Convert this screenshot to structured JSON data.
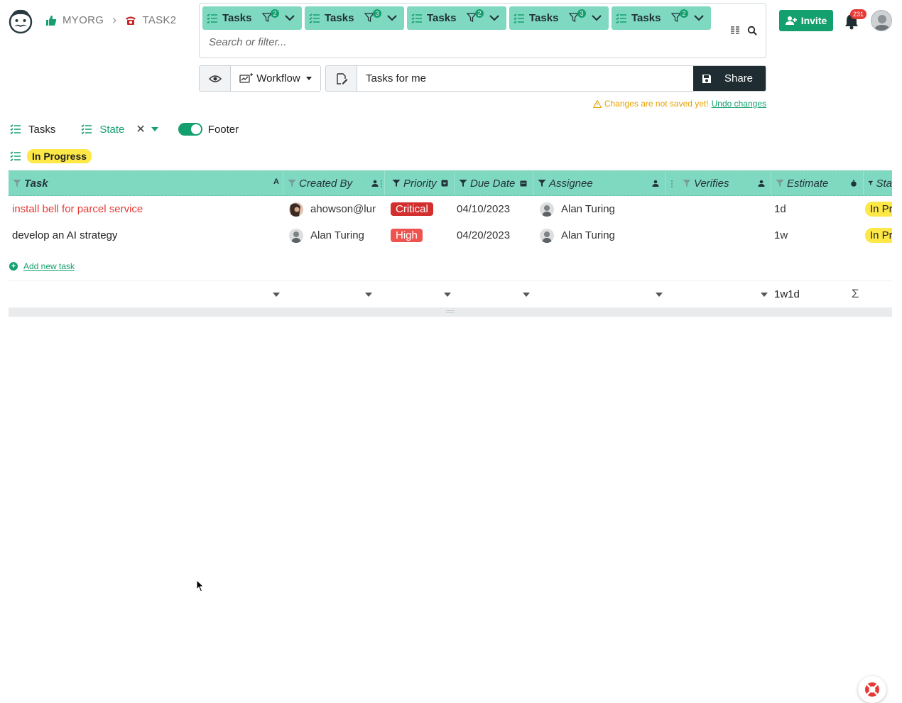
{
  "breadcrumb": {
    "org": "MYORG",
    "project": "TASK2"
  },
  "search": {
    "chips": [
      {
        "label": "Tasks",
        "filter_count": "2"
      },
      {
        "label": "Tasks",
        "filter_count": "3"
      },
      {
        "label": "Tasks",
        "filter_count": "2"
      },
      {
        "label": "Tasks",
        "filter_count": "3"
      },
      {
        "label": "Tasks",
        "filter_count": "2"
      }
    ],
    "placeholder": "Search or filter..."
  },
  "header": {
    "invite_label": "Invite",
    "notification_count": "231"
  },
  "toolbar": {
    "workflow_label": "Workflow",
    "view_name": "Tasks for me",
    "share_label": "Share",
    "unsaved_message": "Changes are not saved yet!",
    "undo_label": "Undo changes"
  },
  "groupbar": {
    "tasks_label": "Tasks",
    "state_label": "State",
    "footer_label": "Footer",
    "footer_enabled": true
  },
  "group": {
    "state": "In Progress"
  },
  "table": {
    "columns": [
      "Task",
      "Created By",
      "Priority",
      "Due Date",
      "Assignee",
      "Verifies",
      "Estimate",
      "Sta"
    ],
    "sort_indicator": "A",
    "rows": [
      {
        "task": "install bell for parcel service",
        "created_by": "ahowson@lun",
        "priority": "Critical",
        "due_date": "04/10/2023",
        "assignee": "Alan Turing",
        "verifies": "",
        "estimate": "1d",
        "state": "In Pr"
      },
      {
        "task": "develop an AI strategy",
        "created_by": "Alan Turing",
        "priority": "High",
        "due_date": "04/20/2023",
        "assignee": "Alan Turing",
        "verifies": "",
        "estimate": "1w",
        "state": "In Pr"
      }
    ],
    "add_new_label": "Add new task",
    "estimate_total": "1w1d"
  },
  "colors": {
    "accent": "#14a06e",
    "header_bg": "#7fd8c0",
    "critical": "#d32f2f",
    "high": "#ef5350",
    "state_yellow": "#fde848",
    "warning": "#e6a100"
  }
}
